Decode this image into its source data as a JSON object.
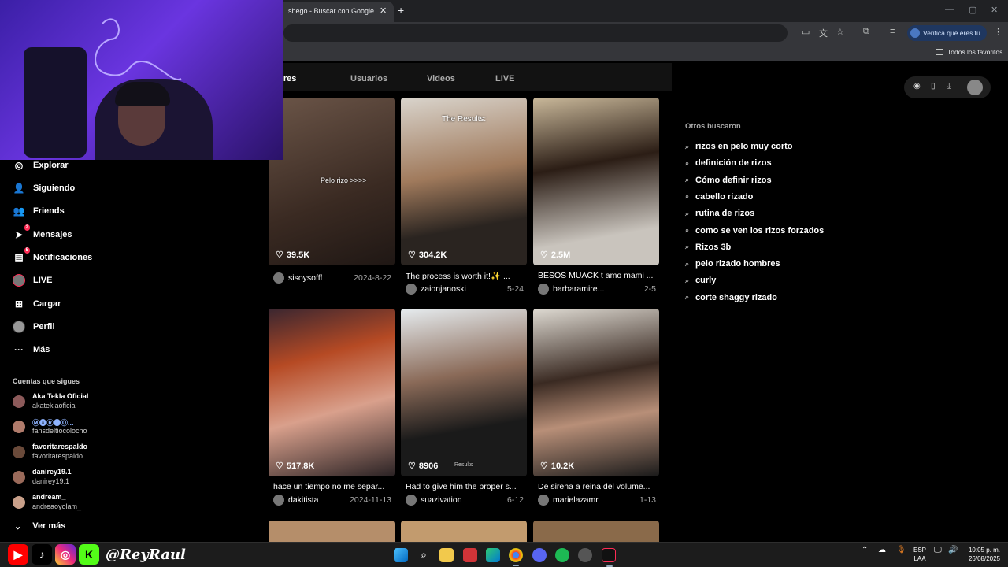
{
  "browser": {
    "tab_title": "shego - Buscar con Google",
    "tab_close": "✕",
    "new_tab": "+",
    "verify_label": "Verifica que eres tú",
    "bookmarks_folder": "Todos los favoritos"
  },
  "sidebar": {
    "items": [
      {
        "label": "Explorar",
        "icon": "compass-icon"
      },
      {
        "label": "Siguiendo",
        "icon": "following-icon"
      },
      {
        "label": "Friends",
        "icon": "friends-icon"
      },
      {
        "label": "Mensajes",
        "icon": "messages-icon",
        "badge": "2"
      },
      {
        "label": "Notificaciones",
        "icon": "notifications-icon",
        "badge": "5"
      },
      {
        "label": "LIVE",
        "icon": "live-avatar"
      },
      {
        "label": "Cargar",
        "icon": "upload-icon"
      },
      {
        "label": "Perfil",
        "icon": "profile-avatar"
      },
      {
        "label": "Más",
        "icon": "more-icon"
      }
    ],
    "following_title": "Cuentas que sigues",
    "following": [
      {
        "name": "Aka Tekla Oficial",
        "handle": "akateklaoficial"
      },
      {
        "name": "Ⓜ🅐Ⓡ🅘Ⓞ...",
        "handle": "fansdeltiocolocho"
      },
      {
        "name": "favoritarespaldo",
        "handle": "favoritarespaldo"
      },
      {
        "name": "danirey19.1",
        "handle": "danirey19.1"
      },
      {
        "name": "andream_",
        "handle": "andreaoyolam_"
      }
    ],
    "see_more": "Ver más"
  },
  "search_tabs": [
    {
      "label": "ulares",
      "active": true
    },
    {
      "label": "Usuarios",
      "active": false
    },
    {
      "label": "Videos",
      "active": false
    },
    {
      "label": "LIVE",
      "active": false
    }
  ],
  "videos": [
    {
      "likes": "39.5K",
      "caption": "",
      "user": "sisoysofff",
      "date": "2024-8-22",
      "overlay": "Pelo rizo >>>>",
      "bg": "linear-gradient(160deg,#6b5548,#3a2a22 60%,#1f1714)"
    },
    {
      "likes": "304.2K",
      "caption": "The process is worth it!✨ ...",
      "user": "zaionjanoski",
      "date": "5-24",
      "overlay": "The Results:",
      "bg": "linear-gradient(170deg,#d9d4cc,#a07a5c 45%,#2a2420 75%)"
    },
    {
      "likes": "2.5M",
      "caption": "BESOS MUACK t amo mami ...",
      "user": "barbaramire...",
      "date": "2-5",
      "overlay": "",
      "bg": "linear-gradient(170deg,#c9b89a,#2b1d15 40%,#c9c4bd 80%)"
    },
    {
      "likes": "517.8K",
      "caption": "hace un tiempo no me separ...",
      "user": "dakitista",
      "date": "2024-11-13",
      "overlay": "",
      "bg": "linear-gradient(165deg,#3a2630,#b64a24 30%,#d9a08c 60%,#2a2224)"
    },
    {
      "likes": "8906",
      "caption": "Had to give him the proper s...",
      "user": "suazivation",
      "date": "6-12",
      "overlay": "Results",
      "bg": "linear-gradient(170deg,#e6ecef,#8a6a58 40%,#1a1a1a 70%)"
    },
    {
      "likes": "10.2K",
      "caption": "De sirena a reina del volume...",
      "user": "marielazamr",
      "date": "1-13",
      "overlay": "",
      "bg": "linear-gradient(170deg,#dedad2,#3a2a22 40%,#b88f78 65%,#1a1a1a)"
    }
  ],
  "related": {
    "title": "Otros buscaron",
    "items": [
      "rizos en pelo muy corto",
      "definición de rizos",
      "Cómo definir rizos",
      "cabello rizado",
      "rutina de rizos",
      "como se ven los rizos forzados",
      "Rizos 3b",
      "pelo rizado hombres",
      "curly",
      "corte shaggy rizado"
    ]
  },
  "overlay": {
    "handle": "@ReyRaul"
  },
  "taskbar": {
    "lang_top": "ESP",
    "lang_bottom": "LAA",
    "time": "10:05 p. m.",
    "date": "26/08/2025"
  }
}
